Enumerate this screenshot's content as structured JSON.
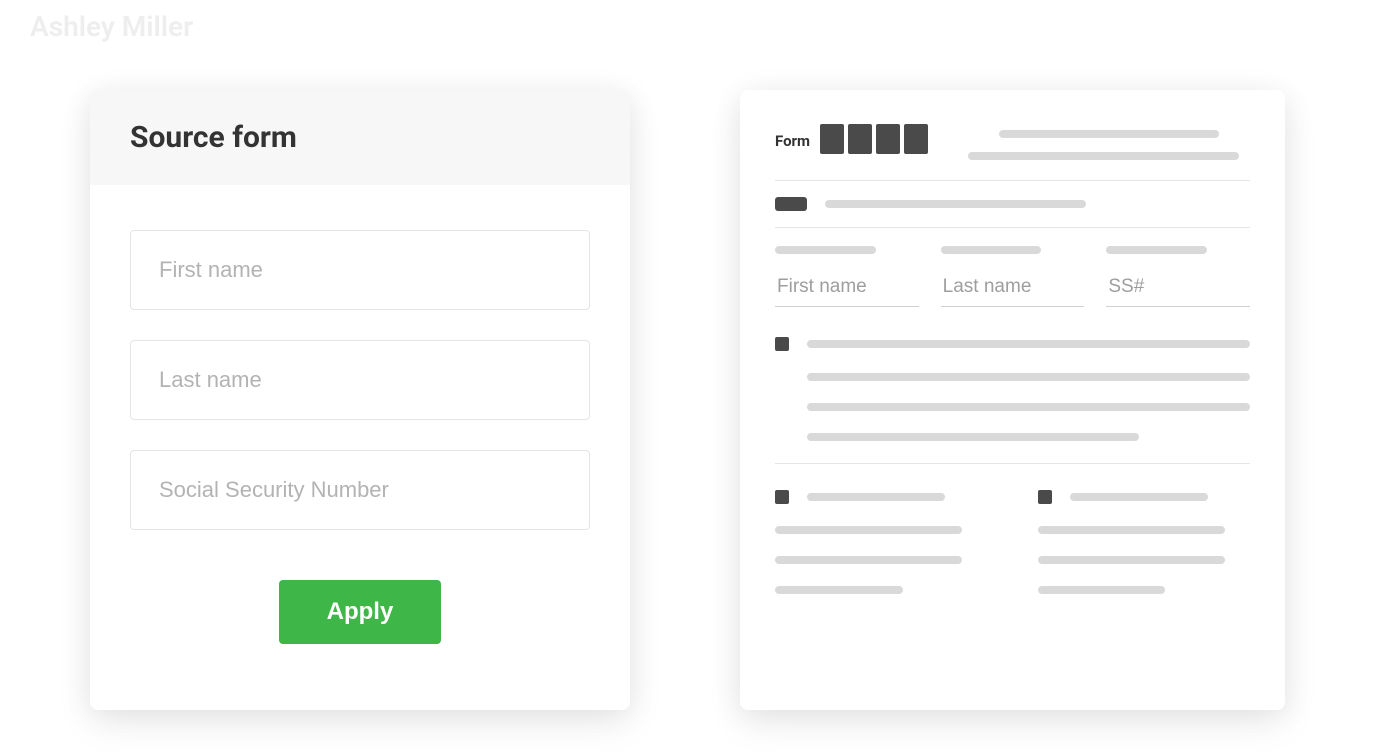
{
  "background": {
    "ghost_name": "Ashley Miller"
  },
  "source_form": {
    "title": "Source form",
    "fields": {
      "first_name": {
        "value": "",
        "placeholder": "First name"
      },
      "last_name": {
        "value": "",
        "placeholder": "Last name"
      },
      "ssn": {
        "value": "",
        "placeholder": "Social Security Number"
      }
    },
    "apply_label": "Apply"
  },
  "document": {
    "form_label": "Form",
    "block_count": 4,
    "fields": {
      "first_name": {
        "placeholder": "First name"
      },
      "last_name": {
        "placeholder": "Last name"
      },
      "ssn": {
        "placeholder": "SS#"
      }
    }
  },
  "colors": {
    "primary_button": "#3fb748",
    "skeleton": "#d9d9d9",
    "dark_block": "#4a4a4a"
  }
}
